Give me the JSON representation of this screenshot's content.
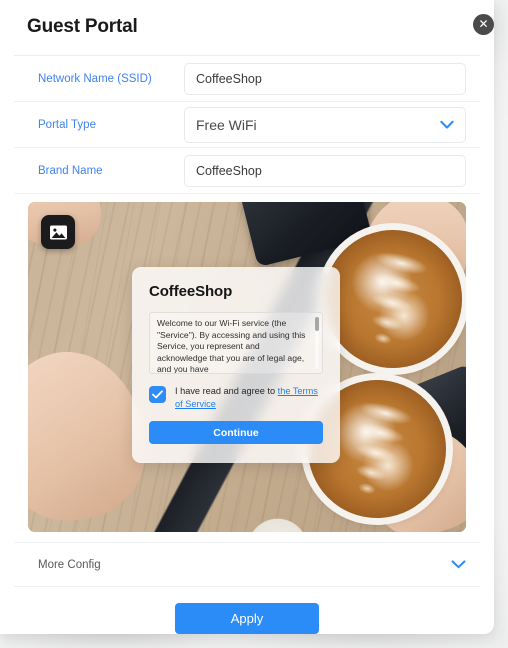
{
  "window": {
    "title": "Guest Portal",
    "close_icon": "close-circle-icon"
  },
  "form": {
    "fields": [
      {
        "label": "Network Name (SSID)",
        "value": "CoffeeShop",
        "type": "text",
        "placeholder": ""
      },
      {
        "label": "Portal Type",
        "value": "Free WiFi",
        "type": "select",
        "chevron_icon": "chevron-down-icon"
      },
      {
        "label": "Brand Name",
        "value": "CoffeeShop",
        "type": "text",
        "placeholder": ""
      }
    ]
  },
  "preview": {
    "upload_icon": "image-placeholder-icon",
    "photo_alt": "coffee shop wooden table with two latte cups and phones",
    "card": {
      "brand": "CoffeeShop",
      "terms_text": "Welcome to our Wi-Fi service (the \"Service\"). By accessing and using this Service, you represent and acknowledge that you are of legal age, and you have",
      "agree_prefix": "I have read and agree to ",
      "agree_link": "the Terms of Service",
      "checkbox_checked": true,
      "checkbox_icon": "check-icon",
      "continue_label": "Continue"
    }
  },
  "more_config": {
    "label": "More Config",
    "chevron_icon": "chevron-down-icon",
    "expanded": false
  },
  "footer": {
    "apply_label": "Apply"
  },
  "colors": {
    "accent_blue": "#2b8cf7",
    "label_blue": "#3f83f0",
    "link_blue": "#1f7ff0",
    "text_dark": "#1a1a1a",
    "panel_white": "#ffffff",
    "page_gray": "#f2f2f3"
  }
}
